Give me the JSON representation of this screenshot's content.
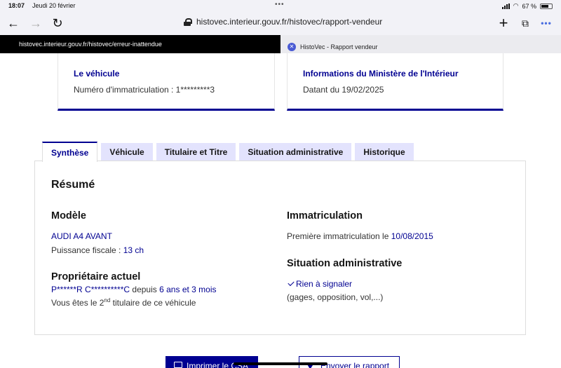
{
  "status_bar": {
    "time": "18:07",
    "date": "Jeudi 20 février",
    "battery": "67 %"
  },
  "browser": {
    "url": "histovec.interieur.gouv.fr/histovec/rapport-vendeur",
    "tabs": [
      {
        "title": "histovec.interieur.gouv.fr/histovec/erreur-inattendue",
        "active": false
      },
      {
        "title": "HistoVec - Rapport vendeur",
        "active": true
      }
    ]
  },
  "cards": {
    "vehicle": {
      "title": "Le véhicule",
      "text": "Numéro d'immatriculation : 1*********3"
    },
    "ministry": {
      "title": "Informations du Ministère de l'Intérieur",
      "text": "Datant du 19/02/2025"
    }
  },
  "tabs": [
    "Synthèse",
    "Véhicule",
    "Titulaire et Titre",
    "Situation administrative",
    "Historique"
  ],
  "summary": {
    "heading": "Résumé",
    "model": {
      "heading": "Modèle",
      "name": "AUDI A4 AVANT",
      "power_label": "Puissance fiscale :",
      "power_value": "13 ch"
    },
    "owner": {
      "heading": "Propriétaire actuel",
      "name": "P******R C**********C",
      "since_label": "depuis",
      "since_value": "6 ans et 3 mois",
      "rank_prefix": "Vous êtes le",
      "rank_num": "2",
      "rank_sup": "nd",
      "rank_suffix": "titulaire de ce véhicule"
    },
    "registration": {
      "heading": "Immatriculation",
      "first_label": "Première immatriculation le",
      "first_date": "10/08/2015"
    },
    "admin": {
      "heading": "Situation administrative",
      "status": "Rien à signaler",
      "detail": "(gages, opposition, vol,...)"
    }
  },
  "buttons": {
    "print": "Imprimer le CSA",
    "send": "Envoyer le rapport"
  },
  "colors": {
    "primary": "#000091",
    "tab_bg": "#e3e3fd"
  }
}
